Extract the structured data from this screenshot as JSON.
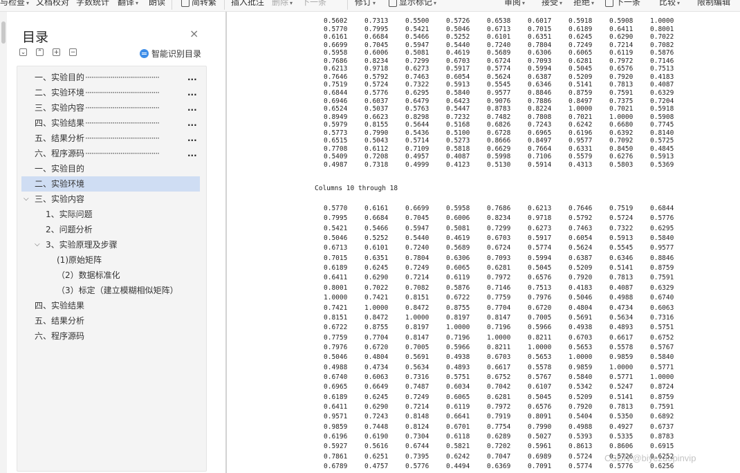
{
  "toolbar": {
    "items": [
      {
        "label": "与检查",
        "caret": true
      },
      {
        "label": "文档校对",
        "caret": false
      },
      {
        "label": "字数统计",
        "caret": false
      },
      {
        "label": "翻译",
        "caret": true
      },
      {
        "label": "朗读",
        "caret": false
      },
      {
        "label": "简转繁",
        "caret": false
      },
      {
        "label": "插入批注",
        "caret": false
      },
      {
        "label": "删除",
        "caret": true
      },
      {
        "label": "下一条",
        "caret": false
      },
      {
        "label": "修订",
        "caret": true
      },
      {
        "label": "显示标记",
        "caret": true
      },
      {
        "label": "审阅",
        "caret": true
      },
      {
        "label": "接受",
        "caret": true
      },
      {
        "label": "拒绝",
        "caret": true
      },
      {
        "label": "下一条",
        "caret": false
      },
      {
        "label": "比较",
        "caret": true
      },
      {
        "label": "限制编辑",
        "caret": false
      }
    ]
  },
  "toc": {
    "title": "目录",
    "close_symbol": "×",
    "smart_label": "智能识别目录",
    "controls": [
      "⌄",
      "⌃",
      "+",
      "−"
    ],
    "items": [
      {
        "label": "一、实验目的",
        "dots": true,
        "level": 0,
        "arrow": ""
      },
      {
        "label": "二、实验环境",
        "dots": true,
        "level": 0,
        "arrow": ""
      },
      {
        "label": "三、实验内容",
        "dots": true,
        "level": 0,
        "arrow": ""
      },
      {
        "label": "四、实验结果",
        "dots": true,
        "level": 0,
        "arrow": ""
      },
      {
        "label": "五、结果分析",
        "dots": true,
        "level": 0,
        "arrow": ""
      },
      {
        "label": "六、程序源码",
        "dots": true,
        "level": 0,
        "arrow": ""
      },
      {
        "label": "一、实验目的",
        "dots": false,
        "level": 0,
        "arrow": ""
      },
      {
        "label": "二、实验环境",
        "dots": false,
        "level": 0,
        "arrow": "",
        "selected": true
      },
      {
        "label": "三、实验内容",
        "dots": false,
        "level": 0,
        "arrow": "expanded"
      },
      {
        "label": "1、实际问题",
        "dots": false,
        "level": 1,
        "arrow": ""
      },
      {
        "label": "2、问题分析",
        "dots": false,
        "level": 1,
        "arrow": ""
      },
      {
        "label": "3、实验原理及步骤",
        "dots": false,
        "level": 1,
        "arrow": "expanded"
      },
      {
        "label": "(1)原始矩阵",
        "dots": false,
        "level": 2,
        "arrow": ""
      },
      {
        "label": "（2）数据标准化",
        "dots": false,
        "level": 2,
        "arrow": ""
      },
      {
        "label": "（3）标定（建立模糊相似矩阵）",
        "dots": false,
        "level": 2,
        "arrow": ""
      },
      {
        "label": "四、实验结果",
        "dots": false,
        "level": 0,
        "arrow": ""
      },
      {
        "label": "五、结果分析",
        "dots": false,
        "level": 0,
        "arrow": ""
      },
      {
        "label": "六、程序源码",
        "dots": false,
        "level": 0,
        "arrow": ""
      }
    ],
    "dot_leader": "······································",
    "ellipsis": "..."
  },
  "doc": {
    "top_table": [
      [
        "0.5602",
        "0.7313",
        "0.5500",
        "0.5726",
        "0.6538",
        "0.6017",
        "0.5918",
        "0.5908",
        "1.0000"
      ],
      [
        "0.5770",
        "0.7995",
        "0.5421",
        "0.5046",
        "0.6713",
        "0.7015",
        "0.6189",
        "0.6411",
        "0.8001"
      ],
      [
        "0.6161",
        "0.6684",
        "0.5466",
        "0.5252",
        "0.6101",
        "0.6351",
        "0.6245",
        "0.6290",
        "0.7022"
      ],
      [
        "0.6699",
        "0.7045",
        "0.5947",
        "0.5440",
        "0.7240",
        "0.7804",
        "0.7249",
        "0.7214",
        "0.7082"
      ],
      [
        "0.5958",
        "0.6006",
        "0.5081",
        "0.4619",
        "0.5689",
        "0.6306",
        "0.6065",
        "0.6119",
        "0.5876"
      ],
      [
        "0.7686",
        "0.8234",
        "0.7299",
        "0.6703",
        "0.6724",
        "0.7093",
        "0.6281",
        "0.7972",
        "0.7146"
      ],
      [
        "0.6213",
        "0.9718",
        "0.6273",
        "0.5917",
        "0.5774",
        "0.5994",
        "0.5045",
        "0.6576",
        "0.7513"
      ],
      [
        "0.7646",
        "0.5792",
        "0.7463",
        "0.6054",
        "0.5624",
        "0.6387",
        "0.5209",
        "0.7920",
        "0.4183"
      ],
      [
        "0.7519",
        "0.5724",
        "0.7322",
        "0.5913",
        "0.5545",
        "0.6346",
        "0.5141",
        "0.7813",
        "0.4087"
      ],
      [
        "0.6844",
        "0.5776",
        "0.6295",
        "0.5840",
        "0.9577",
        "0.8846",
        "0.8759",
        "0.7591",
        "0.6329"
      ],
      [
        "0.6946",
        "0.6037",
        "0.6479",
        "0.6423",
        "0.9076",
        "0.7886",
        "0.8497",
        "0.7375",
        "0.7204"
      ],
      [
        "0.6524",
        "0.5037",
        "0.5763",
        "0.5447",
        "0.8783",
        "0.8224",
        "1.0000",
        "0.7021",
        "0.5918"
      ],
      [
        "0.8949",
        "0.6623",
        "0.8298",
        "0.7232",
        "0.7482",
        "0.7808",
        "0.7021",
        "1.0000",
        "0.5908"
      ],
      [
        "0.5979",
        "0.8155",
        "0.5644",
        "0.5168",
        "0.6826",
        "0.7243",
        "0.6242",
        "0.6680",
        "0.7745"
      ],
      [
        "0.5773",
        "0.7990",
        "0.5436",
        "0.5100",
        "0.6728",
        "0.6965",
        "0.6196",
        "0.6392",
        "0.8140"
      ],
      [
        "0.6515",
        "0.5043",
        "0.5714",
        "0.5273",
        "0.8666",
        "0.8497",
        "0.9577",
        "0.7092",
        "0.5725"
      ],
      [
        "0.7708",
        "0.6112",
        "0.7109",
        "0.5818",
        "0.6629",
        "0.7664",
        "0.6331",
        "0.8450",
        "0.4845"
      ],
      [
        "0.5409",
        "0.7208",
        "0.4957",
        "0.4087",
        "0.5998",
        "0.7106",
        "0.5579",
        "0.6276",
        "0.5913"
      ],
      [
        "0.4987",
        "0.7318",
        "0.4999",
        "0.4123",
        "0.5130",
        "0.5914",
        "0.4313",
        "0.5803",
        "0.5369"
      ]
    ],
    "columns_header": "Columns 10 through 18",
    "bottom_table": [
      [
        "0.5770",
        "0.6161",
        "0.6699",
        "0.5958",
        "0.7686",
        "0.6213",
        "0.7646",
        "0.7519",
        "0.6844"
      ],
      [
        "0.7995",
        "0.6684",
        "0.7045",
        "0.6006",
        "0.8234",
        "0.9718",
        "0.5792",
        "0.5724",
        "0.5776"
      ],
      [
        "0.5421",
        "0.5466",
        "0.5947",
        "0.5081",
        "0.7299",
        "0.6273",
        "0.7463",
        "0.7322",
        "0.6295"
      ],
      [
        "0.5046",
        "0.5252",
        "0.5440",
        "0.4619",
        "0.6703",
        "0.5917",
        "0.6054",
        "0.5913",
        "0.5840"
      ],
      [
        "0.6713",
        "0.6101",
        "0.7240",
        "0.5689",
        "0.6724",
        "0.5774",
        "0.5624",
        "0.5545",
        "0.9577"
      ],
      [
        "0.7015",
        "0.6351",
        "0.7804",
        "0.6306",
        "0.7093",
        "0.5994",
        "0.6387",
        "0.6346",
        "0.8846"
      ],
      [
        "0.6189",
        "0.6245",
        "0.7249",
        "0.6065",
        "0.6281",
        "0.5045",
        "0.5209",
        "0.5141",
        "0.8759"
      ],
      [
        "0.6411",
        "0.6290",
        "0.7214",
        "0.6119",
        "0.7972",
        "0.6576",
        "0.7920",
        "0.7813",
        "0.7591"
      ],
      [
        "0.8001",
        "0.7022",
        "0.7082",
        "0.5876",
        "0.7146",
        "0.7513",
        "0.4183",
        "0.4087",
        "0.6329"
      ],
      [
        "1.0000",
        "0.7421",
        "0.8151",
        "0.6722",
        "0.7759",
        "0.7976",
        "0.5046",
        "0.4988",
        "0.6740"
      ],
      [
        "0.7421",
        "1.0000",
        "0.8472",
        "0.8755",
        "0.7704",
        "0.6720",
        "0.4804",
        "0.4734",
        "0.6063"
      ],
      [
        "0.8151",
        "0.8472",
        "1.0000",
        "0.8197",
        "0.8147",
        "0.7005",
        "0.5691",
        "0.5634",
        "0.7316"
      ],
      [
        "0.6722",
        "0.8755",
        "0.8197",
        "1.0000",
        "0.7196",
        "0.5966",
        "0.4938",
        "0.4893",
        "0.5751"
      ],
      [
        "0.7759",
        "0.7704",
        "0.8147",
        "0.7196",
        "1.0000",
        "0.8211",
        "0.6703",
        "0.6617",
        "0.6752"
      ],
      [
        "0.7976",
        "0.6720",
        "0.7005",
        "0.5966",
        "0.8211",
        "1.0000",
        "0.5653",
        "0.5578",
        "0.5767"
      ],
      [
        "0.5046",
        "0.4804",
        "0.5691",
        "0.4938",
        "0.6703",
        "0.5653",
        "1.0000",
        "0.9859",
        "0.5840"
      ],
      [
        "0.4988",
        "0.4734",
        "0.5634",
        "0.4893",
        "0.6617",
        "0.5578",
        "0.9859",
        "1.0000",
        "0.5771"
      ],
      [
        "0.6740",
        "0.6063",
        "0.7316",
        "0.5751",
        "0.6752",
        "0.5767",
        "0.5840",
        "0.5771",
        "1.0000"
      ],
      [
        "0.6965",
        "0.6649",
        "0.7487",
        "0.6034",
        "0.7042",
        "0.6107",
        "0.5342",
        "0.5247",
        "0.8724"
      ],
      [
        "0.6189",
        "0.6245",
        "0.7249",
        "0.6065",
        "0.6281",
        "0.5045",
        "0.5209",
        "0.5141",
        "0.8759"
      ],
      [
        "0.6411",
        "0.6290",
        "0.7214",
        "0.6119",
        "0.7972",
        "0.6576",
        "0.7920",
        "0.7813",
        "0.7591"
      ],
      [
        "0.9571",
        "0.7243",
        "0.8148",
        "0.6641",
        "0.7919",
        "0.8091",
        "0.5404",
        "0.5350",
        "0.6892"
      ],
      [
        "0.9859",
        "0.7448",
        "0.8124",
        "0.6701",
        "0.7754",
        "0.7990",
        "0.4988",
        "0.4927",
        "0.6737"
      ],
      [
        "0.6196",
        "0.6190",
        "0.7304",
        "0.6118",
        "0.6289",
        "0.5027",
        "0.5393",
        "0.5335",
        "0.8783"
      ],
      [
        "0.5927",
        "0.5616",
        "0.6744",
        "0.5821",
        "0.7202",
        "0.5961",
        "0.8613",
        "0.8606",
        "0.6915"
      ],
      [
        "0.7861",
        "0.6251",
        "0.7395",
        "0.6242",
        "0.7047",
        "0.6989",
        "0.5724",
        "0.5726",
        "0.6252"
      ],
      [
        "0.6789",
        "0.4757",
        "0.5776",
        "0.4494",
        "0.6369",
        "0.7091",
        "0.5774",
        "0.5776",
        "0.6256"
      ]
    ],
    "watermark": "CSDN @biyezuopinvip"
  }
}
